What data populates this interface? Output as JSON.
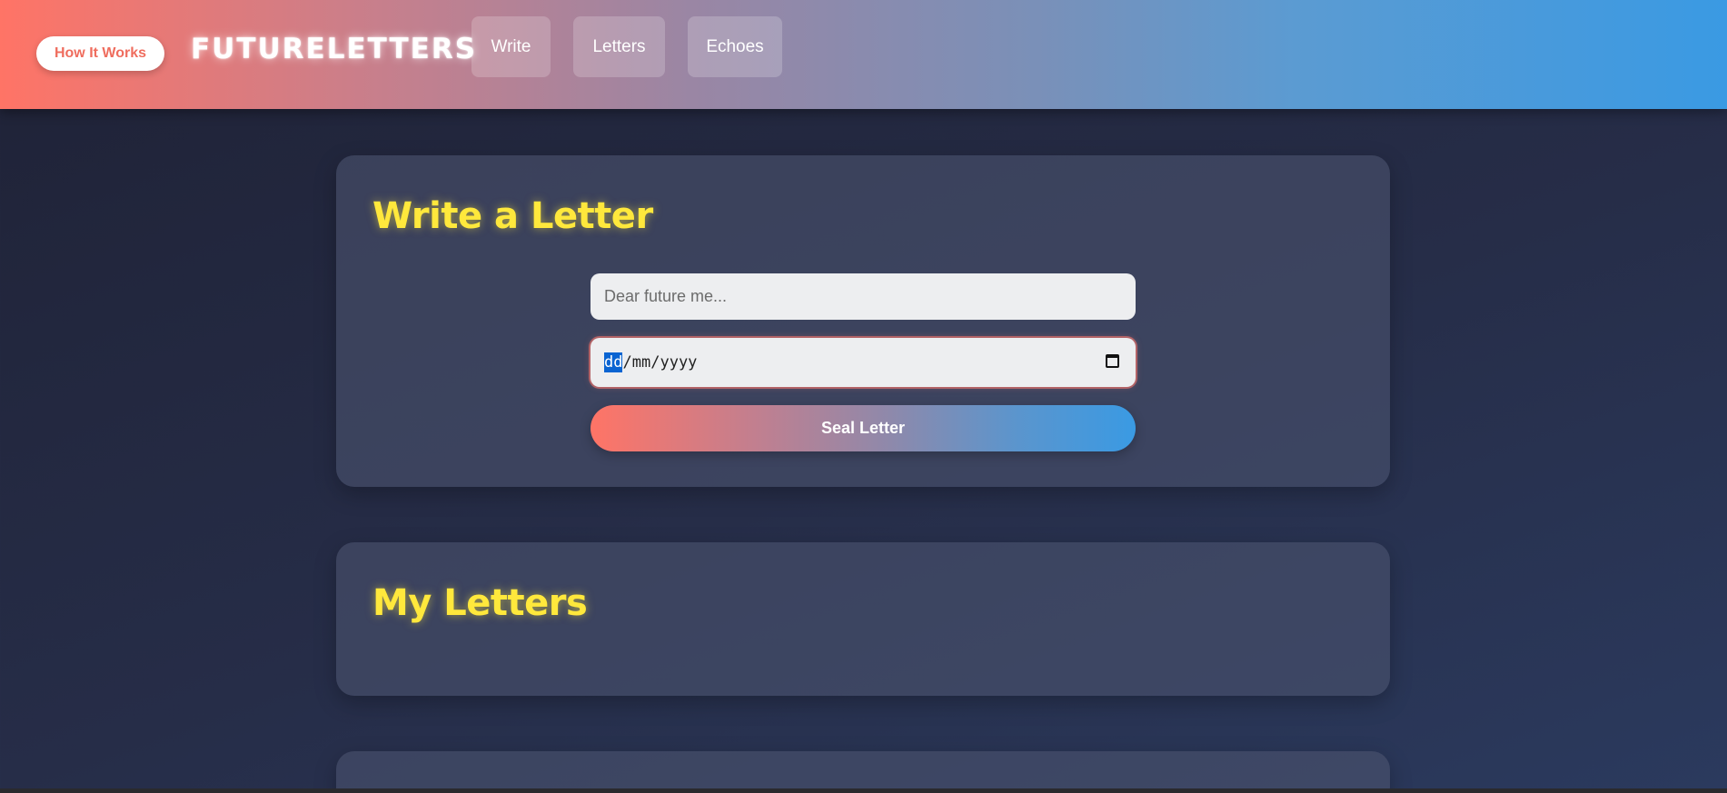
{
  "header": {
    "how_it_works_label": "How It Works",
    "brand": "FUTURELETTERS",
    "nav": [
      {
        "label": "Write"
      },
      {
        "label": "Letters"
      },
      {
        "label": "Echoes"
      }
    ]
  },
  "write_section": {
    "title": "Write a Letter",
    "letter_placeholder": "Dear future me...",
    "date_placeholder": {
      "day": "dd",
      "separator": "/",
      "month": "mm",
      "year": "yyyy"
    },
    "seal_button_label": "Seal Letter"
  },
  "letters_section": {
    "title": "My Letters"
  },
  "colors": {
    "accent_yellow": "#ffe83c",
    "gradient_start": "#ff7466",
    "gradient_end": "#3a9ae3",
    "date_selection": "#0a64d2"
  }
}
